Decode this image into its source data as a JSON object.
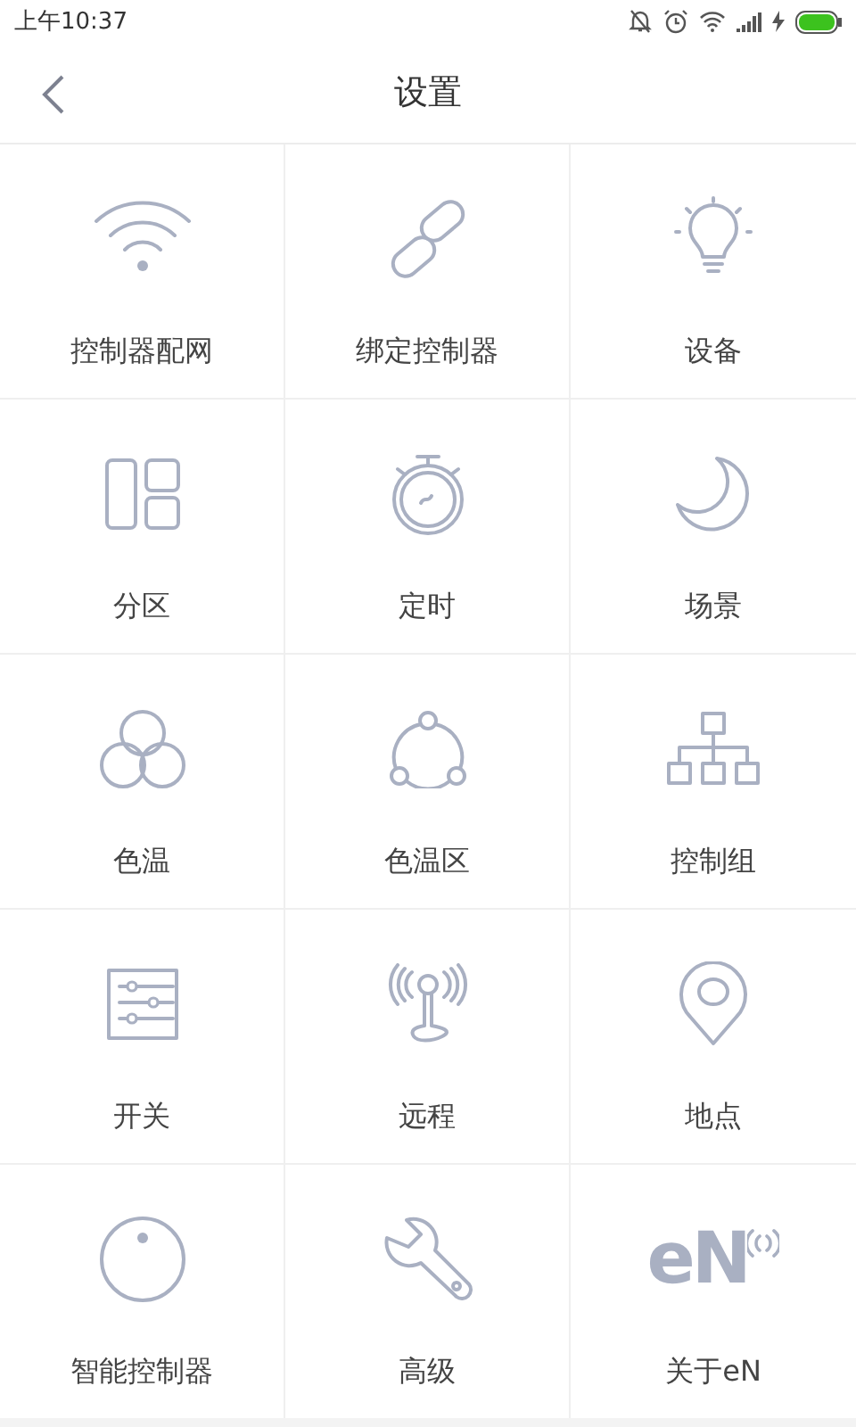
{
  "status_bar": {
    "time": "上午10:37"
  },
  "header": {
    "title": "设置"
  },
  "items": [
    {
      "kind": "wifi",
      "label": "控制器配网"
    },
    {
      "kind": "link",
      "label": "绑定控制器"
    },
    {
      "kind": "bulb",
      "label": "设备"
    },
    {
      "kind": "layout",
      "label": "分区"
    },
    {
      "kind": "stopwatch",
      "label": "定时"
    },
    {
      "kind": "moon",
      "label": "场景"
    },
    {
      "kind": "circles",
      "label": "色温"
    },
    {
      "kind": "triangle",
      "label": "色温区"
    },
    {
      "kind": "tree",
      "label": "控制组"
    },
    {
      "kind": "sliders",
      "label": "开关"
    },
    {
      "kind": "antenna",
      "label": "远程"
    },
    {
      "kind": "pin",
      "label": "地点"
    },
    {
      "kind": "knob",
      "label": "智能控制器"
    },
    {
      "kind": "wrench",
      "label": "高级"
    },
    {
      "kind": "logo",
      "label": "关于eN"
    }
  ],
  "logo": {
    "text": "eN"
  }
}
